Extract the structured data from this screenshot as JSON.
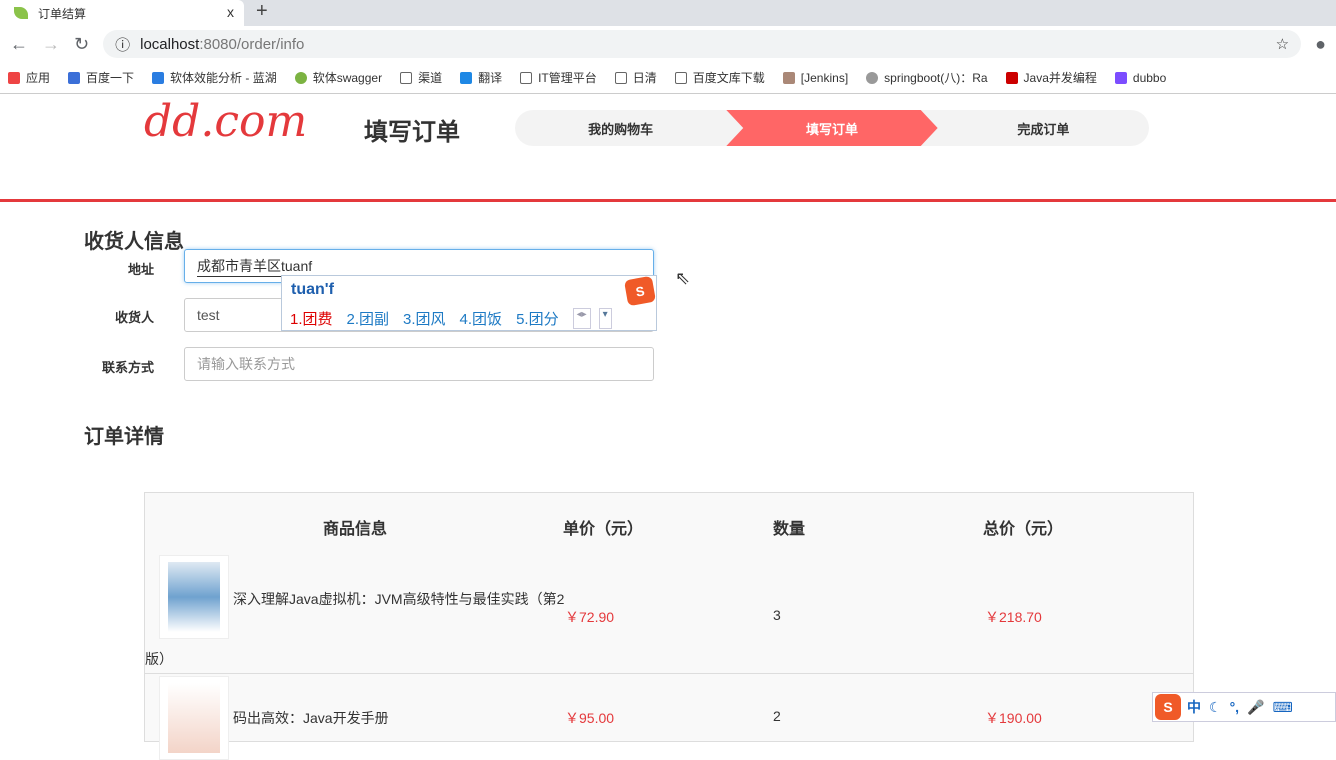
{
  "browser": {
    "tab_title": "订单结算",
    "close": "x",
    "new_tab": "+",
    "url_host": "localhost",
    "url_path": ":8080/order/info",
    "bookmarks": [
      "应用",
      "百度一下",
      "软体效能分析 - 蓝湖",
      "软体swagger",
      "渠道",
      "翻译",
      "IT管理平台",
      "日清",
      "百度文库下载",
      "[Jenkins]",
      "springboot(八)：Ra",
      "Java并发编程",
      "dubbo"
    ]
  },
  "header": {
    "logo": "dd.com",
    "title": "填写订单",
    "steps": [
      "我的购物车",
      "填写订单",
      "完成订单"
    ]
  },
  "receiver": {
    "heading": "收货人信息",
    "address_label": "地址",
    "address_value": "成都市青羊区tuanf",
    "name_label": "收货人",
    "name_value": "test",
    "contact_label": "联系方式",
    "contact_placeholder": "请输入联系方式"
  },
  "ime": {
    "pinyin": "tuan'f",
    "candidates": [
      "1.团费",
      "2.团副",
      "3.团风",
      "4.团饭",
      "5.团分"
    ],
    "status": [
      "中",
      "☾",
      "°,",
      "🎤",
      "⌨"
    ]
  },
  "order": {
    "heading": "订单详情",
    "columns": [
      "商品信息",
      "单价（元）",
      "数量",
      "总价（元）"
    ],
    "items": [
      {
        "name": "深入理解Java虚拟机：JVM高级特性与最佳实践（第2",
        "name_cont": "版）",
        "price": "￥72.90",
        "qty": "3",
        "total": "￥218.70"
      },
      {
        "name": "码出高效：Java开发手册",
        "price": "￥95.00",
        "qty": "2",
        "total": "￥190.00"
      }
    ]
  }
}
